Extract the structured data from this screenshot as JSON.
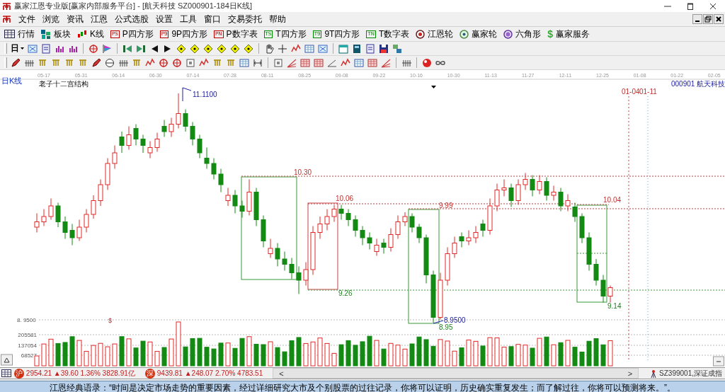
{
  "window": {
    "title": "赢家江恩专业版[赢家内部服务平台] - [航天科技  SZ000901-184日K线]"
  },
  "menu": [
    "文件",
    "浏览",
    "资讯",
    "江恩",
    "公式选股",
    "设置",
    "工具",
    "窗口",
    "交易委托",
    "帮助"
  ],
  "toolbar": [
    {
      "kind": "grid",
      "label": "行情"
    },
    {
      "kind": "blocks",
      "label": "板块"
    },
    {
      "kind": "candles",
      "label": "K线"
    },
    {
      "kind": "badge",
      "badge": "PS",
      "label": "P四方形"
    },
    {
      "kind": "badge",
      "badge": "P9",
      "label": "9P四方形"
    },
    {
      "kind": "badge",
      "badge": "PN",
      "label": "P数字表"
    },
    {
      "kind": "badge",
      "badge": "TS",
      "label": "T四方形"
    },
    {
      "kind": "badge",
      "badge": "T9",
      "label": "9T四方形"
    },
    {
      "kind": "badge",
      "badge": "TN",
      "label": "T数字表"
    },
    {
      "kind": "ring",
      "label": "江恩轮"
    },
    {
      "kind": "wheel",
      "label": "赢家轮"
    },
    {
      "kind": "hex",
      "label": "六角形"
    },
    {
      "kind": "dollar",
      "badge": "$",
      "label": "赢家服务"
    }
  ],
  "period_selector": {
    "label": "日"
  },
  "chart": {
    "period_label": "日K线",
    "dates": [
      "05-17",
      "05-31",
      "06-14",
      "06-30",
      "07-14",
      "07-28",
      "08-11",
      "08-25",
      "09-08",
      "09-22",
      "10-16",
      "10-30",
      "11-13",
      "11-27",
      "12-11",
      "12-25",
      "01-08",
      "01-22",
      "02-05"
    ],
    "indicator_title": "老子十二宫结构",
    "stock": {
      "code": "000901",
      "name": "航天科技"
    },
    "annotations": [
      {
        "kind": "high",
        "text": "11.1100"
      },
      {
        "kind": "resistance",
        "text": "10.30"
      },
      {
        "kind": "resistance",
        "text": "10.06"
      },
      {
        "kind": "resistance",
        "text": "9.99"
      },
      {
        "kind": "resistance",
        "text": "10.04"
      },
      {
        "kind": "support",
        "text": "9.26"
      },
      {
        "kind": "support",
        "text": "9.14"
      },
      {
        "kind": "low",
        "text": "8.9500"
      },
      {
        "kind": "support",
        "text": "8.95"
      },
      {
        "kind": "date-marker",
        "text": "01-04"
      },
      {
        "kind": "date-marker",
        "text": "01-11"
      }
    ],
    "price_axis_label": "8. 9500",
    "signal_mark": "$",
    "chart_data": {
      "type": "candlestick",
      "ohlc": [
        [
          9.85,
          9.98,
          9.8,
          9.9
        ],
        [
          9.9,
          10.02,
          9.86,
          9.95
        ],
        [
          9.95,
          10.12,
          9.92,
          10.05
        ],
        [
          10.05,
          10.08,
          9.85,
          9.9
        ],
        [
          9.9,
          9.95,
          9.74,
          9.8
        ],
        [
          9.82,
          9.88,
          9.68,
          9.75
        ],
        [
          9.75,
          9.92,
          9.72,
          9.85
        ],
        [
          9.85,
          10.02,
          9.8,
          9.97
        ],
        [
          9.97,
          10.15,
          9.93,
          10.1
        ],
        [
          10.1,
          10.3,
          10.05,
          10.25
        ],
        [
          10.25,
          10.5,
          10.2,
          10.45
        ],
        [
          10.45,
          10.62,
          10.4,
          10.55
        ],
        [
          10.7,
          10.75,
          10.55,
          10.62
        ],
        [
          10.62,
          10.8,
          10.58,
          10.72
        ],
        [
          10.78,
          10.82,
          10.62,
          10.68
        ],
        [
          10.68,
          10.72,
          10.55,
          10.62
        ],
        [
          10.55,
          10.66,
          10.5,
          10.6
        ],
        [
          10.6,
          10.74,
          10.56,
          10.68
        ],
        [
          10.8,
          10.86,
          10.7,
          10.75
        ],
        [
          10.75,
          10.88,
          10.7,
          10.82
        ],
        [
          10.82,
          11.11,
          10.78,
          10.92
        ],
        [
          10.92,
          10.96,
          10.75,
          10.8
        ],
        [
          10.8,
          10.84,
          10.62,
          10.68
        ],
        [
          10.68,
          10.72,
          10.5,
          10.55
        ],
        [
          10.5,
          10.6,
          10.4,
          10.45
        ],
        [
          10.45,
          10.5,
          10.3,
          10.35
        ],
        [
          10.35,
          10.4,
          10.18,
          10.25
        ],
        [
          10.1,
          10.22,
          10.05,
          10.15
        ],
        [
          10.15,
          10.2,
          9.98,
          10.05
        ],
        [
          10.05,
          10.1,
          9.94,
          10.0
        ],
        [
          10.0,
          10.3,
          9.96,
          10.18
        ],
        [
          10.18,
          10.22,
          9.86,
          9.92
        ],
        [
          9.92,
          9.96,
          9.66,
          9.72
        ],
        [
          9.6,
          9.74,
          9.56,
          9.65
        ],
        [
          9.65,
          9.7,
          9.48,
          9.55
        ],
        [
          9.55,
          9.62,
          9.44,
          9.5
        ],
        [
          9.5,
          9.56,
          9.36,
          9.42
        ],
        [
          9.42,
          9.48,
          9.22,
          9.35
        ],
        [
          9.35,
          9.52,
          9.3,
          9.45
        ],
        [
          9.45,
          9.86,
          9.4,
          9.8
        ],
        [
          9.8,
          9.95,
          9.74,
          9.88
        ],
        [
          9.88,
          10.02,
          9.82,
          9.95
        ],
        [
          9.95,
          10.06,
          9.9,
          10.02
        ],
        [
          10.02,
          10.06,
          9.92,
          9.98
        ],
        [
          9.98,
          10.02,
          9.86,
          9.92
        ],
        [
          9.92,
          9.96,
          9.76,
          9.82
        ],
        [
          9.82,
          9.86,
          9.68,
          9.75
        ],
        [
          9.75,
          9.8,
          9.64,
          9.7
        ],
        [
          9.62,
          9.74,
          9.58,
          9.68
        ],
        [
          9.7,
          9.74,
          9.6,
          9.66
        ],
        [
          9.66,
          9.84,
          9.62,
          9.78
        ],
        [
          9.78,
          9.96,
          9.74,
          9.9
        ],
        [
          9.9,
          9.99,
          9.86,
          9.95
        ],
        [
          9.95,
          9.98,
          9.8,
          9.85
        ],
        [
          9.85,
          9.88,
          9.7,
          9.75
        ],
        [
          9.75,
          9.78,
          9.32,
          9.4
        ],
        [
          9.4,
          9.44,
          8.95,
          9.0
        ],
        [
          9.0,
          9.42,
          8.98,
          9.35
        ],
        [
          9.35,
          9.66,
          9.3,
          9.6
        ],
        [
          9.6,
          9.76,
          9.56,
          9.7
        ],
        [
          9.76,
          9.8,
          9.66,
          9.72
        ],
        [
          9.72,
          9.82,
          9.68,
          9.75
        ],
        [
          9.75,
          9.86,
          9.7,
          9.8
        ],
        [
          9.88,
          9.92,
          9.76,
          9.82
        ],
        [
          9.82,
          10.12,
          9.78,
          10.05
        ],
        [
          10.05,
          10.26,
          10.0,
          10.2
        ],
        [
          10.2,
          10.3,
          10.14,
          10.22
        ],
        [
          10.22,
          10.26,
          10.04,
          10.1
        ],
        [
          10.1,
          10.3,
          10.06,
          10.25
        ],
        [
          10.25,
          10.36,
          10.2,
          10.3
        ],
        [
          10.3,
          10.34,
          10.14,
          10.2
        ],
        [
          10.2,
          10.34,
          10.16,
          10.28
        ],
        [
          10.28,
          10.32,
          10.1,
          10.15
        ],
        [
          10.15,
          10.24,
          10.1,
          10.18
        ],
        [
          10.18,
          10.22,
          10.0,
          10.05
        ],
        [
          10.05,
          10.16,
          10.0,
          10.1
        ],
        [
          10.04,
          10.08,
          9.9,
          9.95
        ],
        [
          9.95,
          9.98,
          9.7,
          9.75
        ],
        [
          9.75,
          9.8,
          9.44,
          9.5
        ],
        [
          9.5,
          9.55,
          9.3,
          9.35
        ],
        [
          9.35,
          9.4,
          9.14,
          9.2
        ],
        [
          9.2,
          9.3,
          9.14,
          9.28
        ]
      ]
    },
    "volume_ticks": [
      "205581",
      "137054",
      "68527"
    ]
  },
  "status_bar": {
    "indices": [
      {
        "badge": "沪",
        "text": "2954.21 ▲39.60 1.36% 3828.91亿"
      },
      {
        "badge": "深",
        "text": "9439.81 ▲248.07 2.70% 4783.51"
      }
    ],
    "scroll_left": "<",
    "scroll_right": ">",
    "market": "SZ399001,深证成指"
  },
  "quote_ticker": "江恩经典语录：“时间是决定市场走势的重要因素，经过详细研究大市及个别股票的过往记录，你将可以证明，历史确实重复发生；而了解过往，你将可以预测将来。”。"
}
